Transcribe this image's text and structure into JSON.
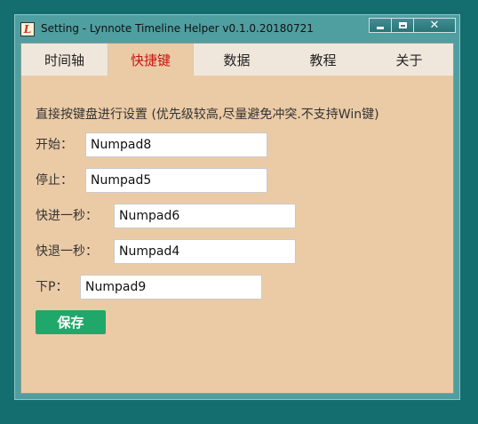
{
  "window": {
    "title": "Setting - Lynnote Timeline Helper v0.1.0.20180721",
    "app_icon_glyph": "L",
    "minimize_icon": "minimize-icon",
    "maximize_icon": "maximize-icon",
    "close_glyph": "✕"
  },
  "tabs": [
    {
      "label": "时间轴",
      "active": false
    },
    {
      "label": "快捷键",
      "active": true
    },
    {
      "label": "数据",
      "active": false
    },
    {
      "label": "教程",
      "active": false
    },
    {
      "label": "关于",
      "active": false
    }
  ],
  "description": "直接按键盘进行设置 (优先级较高,尽量避免冲突.不支持Win键)",
  "hotkeys": [
    {
      "label": "开始：",
      "value": "Numpad8"
    },
    {
      "label": "停止：",
      "value": "Numpad5"
    },
    {
      "label": "快进一秒：",
      "value": "Numpad6"
    },
    {
      "label": "快退一秒：",
      "value": "Numpad4"
    },
    {
      "label": "下P：",
      "value": "Numpad9"
    }
  ],
  "save_label": "保存",
  "colors": {
    "desktop": "#146d6f",
    "panel": "#ebcba6",
    "active_tab_text": "#cc1111",
    "save_button": "#20a86a"
  }
}
